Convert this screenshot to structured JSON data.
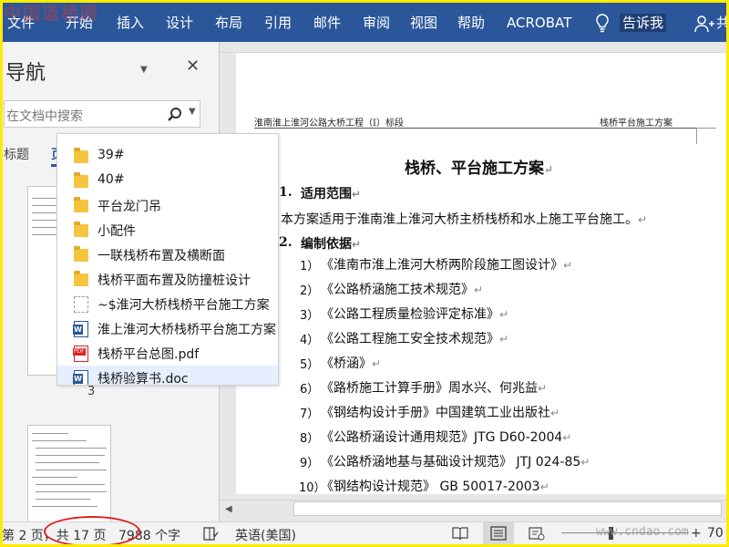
{
  "watermark_top": "中国道桥网",
  "watermark_bottom": "www.cndao.com",
  "ribbon": {
    "menus": [
      "文件",
      "开始",
      "插入",
      "设计",
      "布局",
      "引用",
      "邮件",
      "审阅",
      "视图",
      "帮助",
      "ACROBAT"
    ],
    "tell_me": "告诉我",
    "share": "共"
  },
  "nav": {
    "title": "导航",
    "search_placeholder": "在文档中搜索",
    "tabs": [
      "标题",
      "页"
    ],
    "page_thumb_number": "3"
  },
  "file_list": [
    {
      "name": "39#",
      "type": "folder"
    },
    {
      "name": "40#",
      "type": "folder"
    },
    {
      "name": "平台龙门吊",
      "type": "folder"
    },
    {
      "name": "小配件",
      "type": "folder"
    },
    {
      "name": "一联栈桥布置及横断面",
      "type": "folder"
    },
    {
      "name": "栈桥平面布置及防撞桩设计",
      "type": "folder"
    },
    {
      "name": "~$淮河大桥栈桥平台施工方案",
      "type": "word-temp"
    },
    {
      "name": "淮上淮河大桥栈桥平台施工方案",
      "type": "word"
    },
    {
      "name": "栈桥平台总图.pdf",
      "type": "pdf"
    },
    {
      "name": "栈桥验算书.doc",
      "type": "word"
    }
  ],
  "document": {
    "header_left": "淮南淮上淮河公路大桥工程（I）标段",
    "header_right": "栈桥平台施工方案",
    "title": "栈桥、平台施工方案",
    "section1": {
      "num": "1.",
      "title": "适用范围"
    },
    "paragraph": "本方案适用于淮南淮上淮河大桥主桥栈桥和水上施工平台施工。",
    "section2": {
      "num": "2.",
      "title": "编制依据"
    },
    "references": [
      {
        "num": "1）",
        "text": "《淮南市淮上淮河大桥两阶段施工图设计》"
      },
      {
        "num": "2）",
        "text": "《公路桥涵施工技术规范》"
      },
      {
        "num": "3）",
        "text": "《公路工程质量检验评定标准》"
      },
      {
        "num": "4）",
        "text": "《公路工程施工安全技术规范》"
      },
      {
        "num": "5）",
        "text": "《桥涵》"
      },
      {
        "num": "6）",
        "text": "《路桥施工计算手册》周水兴、何兆益"
      },
      {
        "num": "7）",
        "text": "《钢结构设计手册》中国建筑工业出版社"
      },
      {
        "num": "8）",
        "text": "《公路桥涵设计通用规范》JTG D60-2004"
      },
      {
        "num": "9）",
        "text": "《公路桥涵地基与基础设计规范》 JTJ 024-85"
      },
      {
        "num": "10）",
        "text": "《钢结构设计规范》 GB 50017-2003"
      }
    ]
  },
  "status": {
    "page": "第 2 页，共 17 页",
    "words": "7988 个字",
    "language": "英语(美国)",
    "zoom": "70"
  }
}
